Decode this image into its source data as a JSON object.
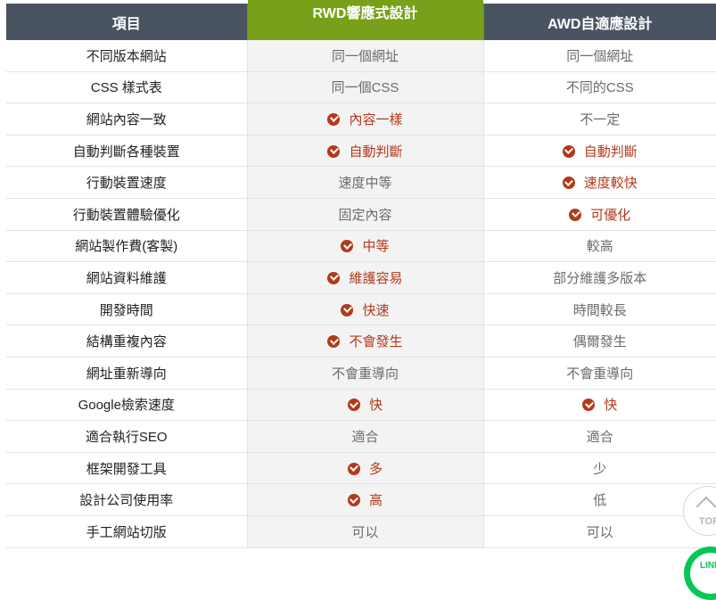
{
  "table": {
    "headers": [
      "項目",
      "RWD響應式設計",
      "AWD自適應設計"
    ],
    "rows": [
      {
        "item": "不同版本網站",
        "rwd": {
          "text": "同一個網址",
          "check": false
        },
        "awd": {
          "text": "同一個網址",
          "check": false
        }
      },
      {
        "item": "CSS 樣式表",
        "rwd": {
          "text": "同一個CSS",
          "check": false
        },
        "awd": {
          "text": "不同的CSS",
          "check": false
        }
      },
      {
        "item": "網站內容一致",
        "rwd": {
          "text": "內容一樣",
          "check": true
        },
        "awd": {
          "text": "不一定",
          "check": false
        }
      },
      {
        "item": "自動判斷各種裝置",
        "rwd": {
          "text": "自動判斷",
          "check": true
        },
        "awd": {
          "text": "自動判斷",
          "check": true
        }
      },
      {
        "item": "行動裝置速度",
        "rwd": {
          "text": "速度中等",
          "check": false
        },
        "awd": {
          "text": "速度較快",
          "check": true
        }
      },
      {
        "item": "行動裝置體驗優化",
        "rwd": {
          "text": "固定內容",
          "check": false
        },
        "awd": {
          "text": "可優化",
          "check": true
        }
      },
      {
        "item": "網站製作費(客製)",
        "rwd": {
          "text": "中等",
          "check": true
        },
        "awd": {
          "text": "較高",
          "check": false
        }
      },
      {
        "item": "網站資料維護",
        "rwd": {
          "text": "維護容易",
          "check": true
        },
        "awd": {
          "text": "部分維護多版本",
          "check": false
        }
      },
      {
        "item": "開發時間",
        "rwd": {
          "text": "快速",
          "check": true
        },
        "awd": {
          "text": "時間較長",
          "check": false
        }
      },
      {
        "item": "結構重複內容",
        "rwd": {
          "text": "不會發生",
          "check": true
        },
        "awd": {
          "text": "偶爾發生",
          "check": false
        }
      },
      {
        "item": "網址重新導向",
        "rwd": {
          "text": "不會重導向",
          "check": false
        },
        "awd": {
          "text": "不會重導向",
          "check": false
        }
      },
      {
        "item": "Google檢索速度",
        "rwd": {
          "text": "快",
          "check": true
        },
        "awd": {
          "text": "快",
          "check": true
        }
      },
      {
        "item": "適合執行SEO",
        "rwd": {
          "text": "適合",
          "check": false
        },
        "awd": {
          "text": "適合",
          "check": false
        }
      },
      {
        "item": "框架開發工具",
        "rwd": {
          "text": "多",
          "check": true
        },
        "awd": {
          "text": "少",
          "check": false
        }
      },
      {
        "item": "設計公司使用率",
        "rwd": {
          "text": "高",
          "check": true
        },
        "awd": {
          "text": "低",
          "check": false
        }
      },
      {
        "item": "手工網站切版",
        "rwd": {
          "text": "可以",
          "check": false
        },
        "awd": {
          "text": "可以",
          "check": false
        }
      }
    ]
  },
  "floating": {
    "top_label": "TOP",
    "line_label": "LINE"
  },
  "colors": {
    "header_dark": "#4a5461",
    "header_green": "#79a01a",
    "highlight": "#b23a1b"
  }
}
